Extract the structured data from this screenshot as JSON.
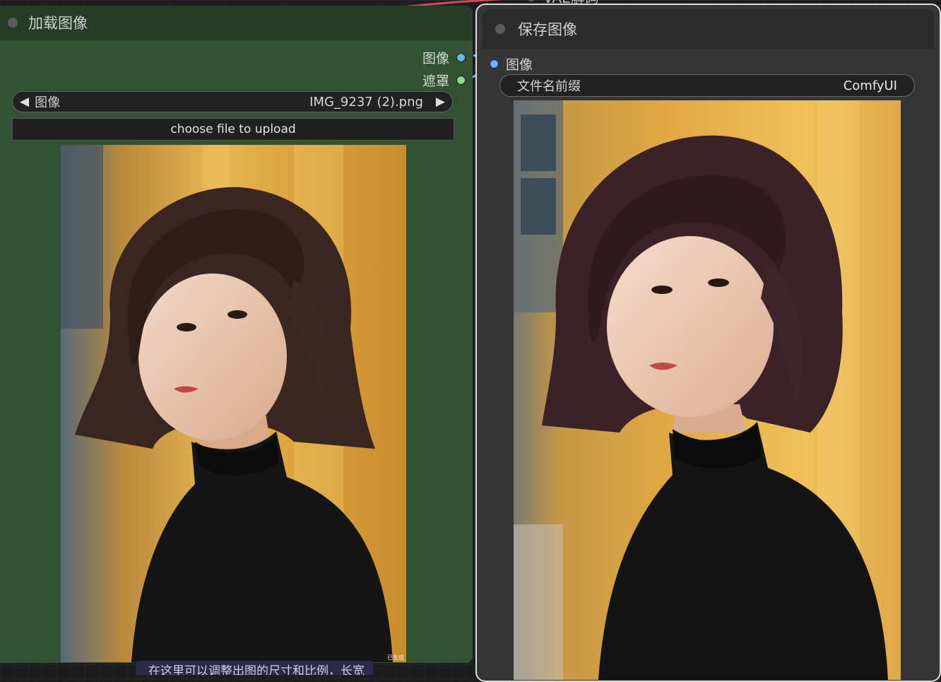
{
  "canvas": {
    "background": "#1d1d1d"
  },
  "top_node": {
    "title": "VAE解码"
  },
  "load_node": {
    "title": "加载图像",
    "color": "#335133",
    "outputs": [
      {
        "label": "图像",
        "color": "#6cb0f2"
      },
      {
        "label": "遮罩",
        "color": "#8ed98e"
      }
    ],
    "image_combo": {
      "name": "图像",
      "value": "IMG_9237 (2).png"
    },
    "upload_label": "choose file to upload",
    "preview_stamp": "已生成"
  },
  "save_node": {
    "title": "保存图像",
    "inputs": [
      {
        "label": "图像",
        "color": "#6cb0f2"
      }
    ],
    "filename_prefix": {
      "name": "文件名前缀",
      "value": "ComfyUI"
    }
  },
  "hint": {
    "text": "在这里可以调整出图的尺寸和比例，长宽"
  },
  "icons": {
    "prev": "◀",
    "next": "▶"
  }
}
